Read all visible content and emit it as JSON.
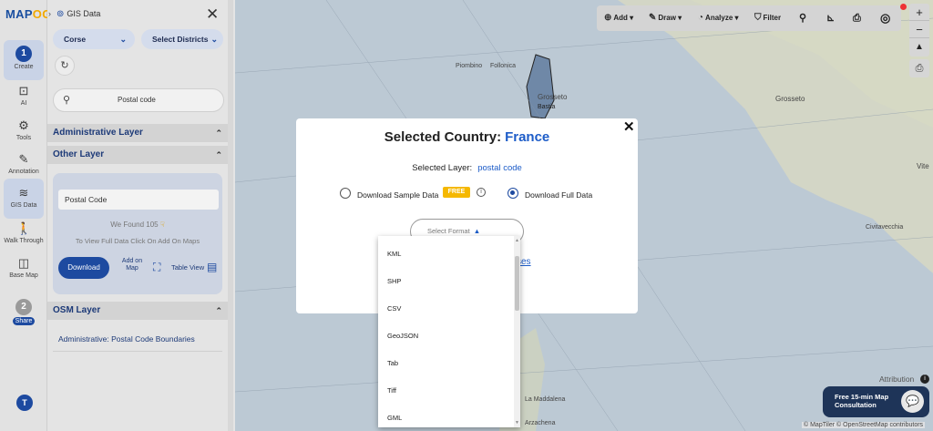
{
  "logo": {
    "text_a": "MAP",
    "text_b": "OG"
  },
  "rail": {
    "create_step": "1",
    "create_label": "Create",
    "ai_label": "AI",
    "tools_label": "Tools",
    "annotation_label": "Annotation",
    "gisdata_label": "GIS Data",
    "walk_label": "Walk Through",
    "basemap_label": "Base Map",
    "share_step": "2",
    "share_label": "Share",
    "avatar_initial": "T"
  },
  "panel": {
    "title": "GIS Data",
    "dropdown_region": "Corse",
    "dropdown_districts": "Select Districts",
    "search_placeholder": "Postal code",
    "admin_layer": "Administrative Layer",
    "other_layer": "Other Layer",
    "layer_input": "Postal Code",
    "found_text": "We Found  105",
    "full_data_text": "To View Full Data Click On Add On Maps",
    "download_label": "Download",
    "add_on_map_label": "Add on Map",
    "table_view_label": "Table View",
    "osm_layer": "OSM Layer",
    "osm_item": "Administrative: Postal Code Boundaries"
  },
  "toolbar": {
    "add": "Add",
    "draw": "Draw",
    "analyze": "Analyze",
    "filter": "Filter"
  },
  "map": {
    "places": {
      "piombino": "Piombino",
      "follonica": "Follonica",
      "grosseto": "Grosseto",
      "civitavecchia": "Civitavecchia",
      "viterbo": "Vite",
      "bastia": "Bastia",
      "la_maddalena": "La Maddalena",
      "arzachena": "Arzachena"
    },
    "attribution": "Attribution",
    "consult_line1": "Free 15-min Map",
    "consult_line2": "Consultation",
    "copyright": "© MapTiler © OpenStreetMap contributors"
  },
  "modal": {
    "title_prefix": "Selected Country:",
    "country": "France",
    "layer_prefix": "Selected Layer:",
    "layer_value": "postal code",
    "sample_label": "Download Sample Data",
    "free_badge": "FREE",
    "full_label": "Download Full Data",
    "select_format": "Select Format",
    "licenses_text": "ses"
  },
  "formats": [
    "KML",
    "SHP",
    "CSV",
    "GeoJSON",
    "Tab",
    "Tiff",
    "GML"
  ],
  "colors": {
    "brand": "#1d4aa0",
    "accent": "#1d5cc8",
    "badge": "#f5b800"
  }
}
